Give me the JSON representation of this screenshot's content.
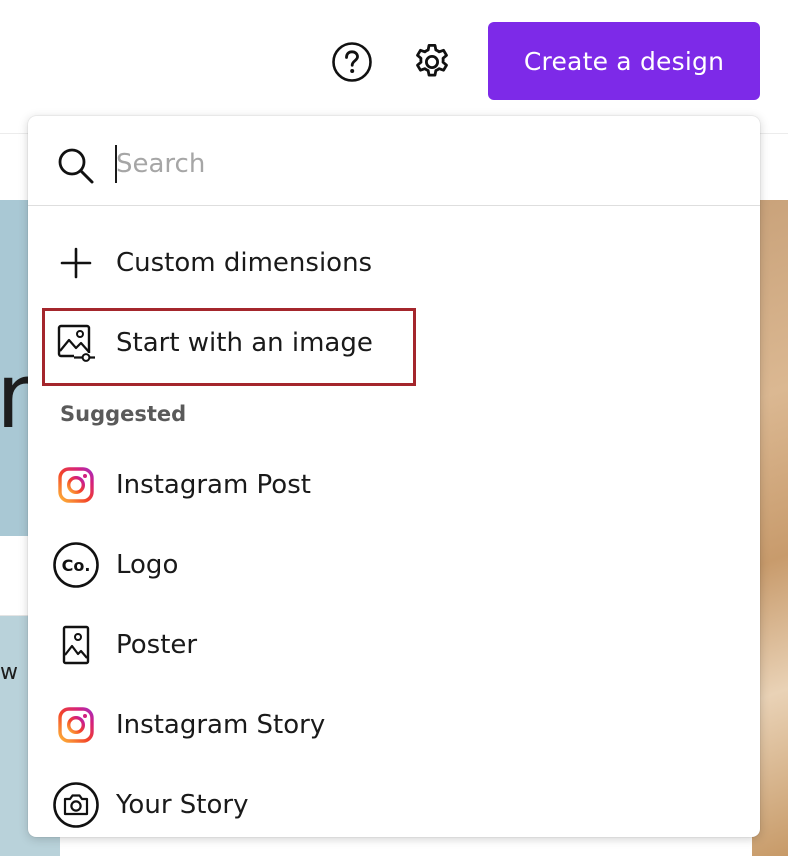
{
  "header": {
    "help_icon": "help-circle-icon",
    "settings_icon": "gear-icon",
    "create_button_label": "Create a design",
    "accent_color": "#7d2ae8"
  },
  "background": {
    "left_letter": "n",
    "left_text": "w"
  },
  "dropdown": {
    "search": {
      "placeholder": "Search",
      "value": ""
    },
    "actions": [
      {
        "label": "Custom dimensions",
        "icon": "plus-icon"
      },
      {
        "label": "Start with an image",
        "icon": "image-upload-icon",
        "highlighted": true,
        "highlight_color": "#a4262c"
      }
    ],
    "suggested_heading": "Suggested",
    "suggested": [
      {
        "label": "Instagram Post",
        "icon": "instagram-icon"
      },
      {
        "label": "Logo",
        "icon": "logo-co-icon"
      },
      {
        "label": "Poster",
        "icon": "poster-icon"
      },
      {
        "label": "Instagram Story",
        "icon": "instagram-icon"
      },
      {
        "label": "Your Story",
        "icon": "camera-icon"
      }
    ]
  }
}
